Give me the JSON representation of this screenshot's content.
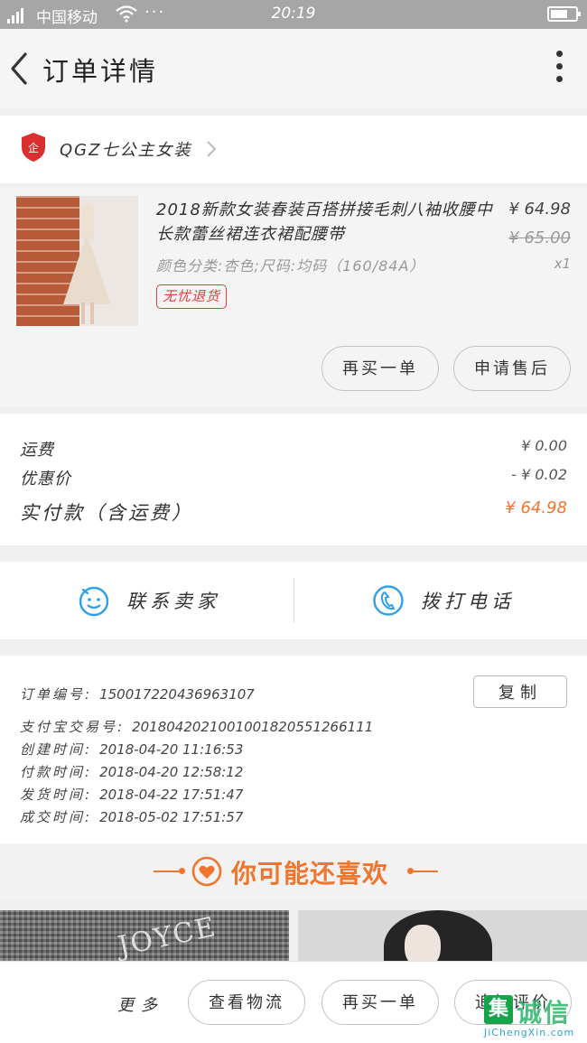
{
  "status_bar": {
    "network": "2G",
    "carrier": "中国移动",
    "dots": "···",
    "time": "20:19"
  },
  "nav": {
    "title": "订单详情"
  },
  "shop": {
    "name": "QGZ七公主女装"
  },
  "product": {
    "title": "2018新款女装春装百搭拼接毛刺八袖收腰中长款蕾丝裙连衣裙配腰带",
    "attributes": "颜色分类:杏色;尺码:均码（160/84A）",
    "price": "¥ 64.98",
    "original_price": "¥ 65.00",
    "quantity": "x1",
    "tag": "无忧退货",
    "buy_again_label": "再买一单",
    "after_sale_label": "申请售后"
  },
  "fees": {
    "shipping_label": "运费",
    "shipping_value": "¥ 0.00",
    "discount_label": "优惠价",
    "discount_value": "- ¥ 0.02",
    "total_label": "实付款（含运费）",
    "total_value": "¥ 64.98"
  },
  "contact": {
    "seller_label": "联系卖家",
    "call_label": "拨打电话"
  },
  "order_info": {
    "order_no_label": "订单编号:",
    "order_no": "1500172204369631​07",
    "copy_label": "复制",
    "alipay_label": "支付宝交易号:",
    "alipay_no": "2018042021001001820551266111",
    "created_label": "创建时间:",
    "created": "2018-04-20 11:16:53",
    "paid_label": "付款时间:",
    "paid": "2018-04-20 12:58:12",
    "shipped_label": "发货时间:",
    "shipped": "2018-04-22 17:51:47",
    "completed_label": "成交时间:",
    "completed": "2018-05-02 17:51:57"
  },
  "recommend": {
    "title": "你可能还喜欢",
    "item1_brand": "JOYCE"
  },
  "bottom_bar": {
    "more_label": "更多",
    "logistics_label": "查看物流",
    "buy_again_label": "再买一单",
    "review_label": "追加评价"
  },
  "watermark": {
    "logo_char": "集",
    "name": "诚信",
    "url": "JiChengXin.com"
  },
  "colors": {
    "accent": "#f0762d",
    "tag_red": "#e33a3a",
    "icon_blue": "#2ea1e6",
    "status_bar": "#a6a6a6"
  }
}
